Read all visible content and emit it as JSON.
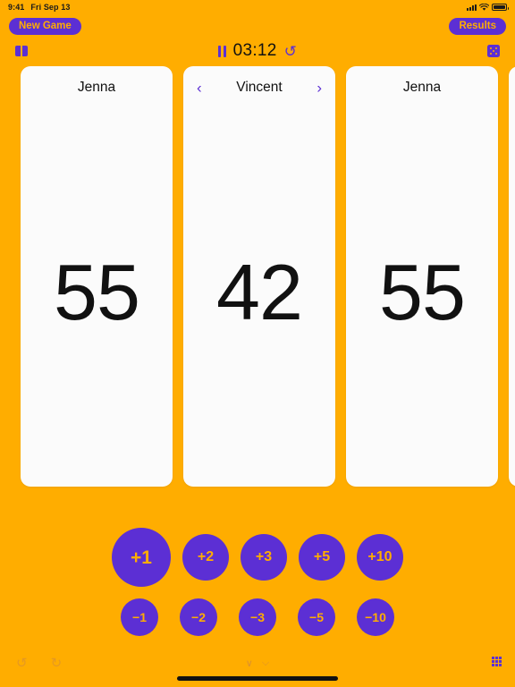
{
  "status_bar": {
    "time": "9:41",
    "date": "Fri Sep 13",
    "signal_icon": "cellular-signal-icon",
    "wifi_icon": "wifi-icon",
    "battery_icon": "battery-icon"
  },
  "nav": {
    "new_game_label": "New Game",
    "results_label": "Results"
  },
  "toolbar": {
    "rules_icon": "book-icon",
    "pause_icon": "pause-icon",
    "timer": "03:12",
    "reset_icon": "↺",
    "dice_icon": "dice-icon"
  },
  "players": [
    {
      "name": "Jenna",
      "score": "55",
      "active": false
    },
    {
      "name": "Vincent",
      "score": "42",
      "active": true,
      "prev_icon": "‹",
      "next_icon": "›"
    },
    {
      "name": "Jenna",
      "score": "55",
      "active": false
    },
    {
      "name": "",
      "score": "",
      "active": false
    }
  ],
  "score_buttons": {
    "plus": [
      {
        "label": "+1",
        "emphasis": true
      },
      {
        "label": "+2",
        "emphasis": false
      },
      {
        "label": "+3",
        "emphasis": false
      },
      {
        "label": "+5",
        "emphasis": false
      },
      {
        "label": "+10",
        "emphasis": false
      }
    ],
    "minus": [
      {
        "label": "−1"
      },
      {
        "label": "−2"
      },
      {
        "label": "−3"
      },
      {
        "label": "−5"
      },
      {
        "label": "−10"
      }
    ]
  },
  "keyboard_bar": {
    "undo_icon": "↺",
    "redo_icon": "↻",
    "format_left_icon": "∨",
    "format_right_icon": "⌵",
    "dismiss_keyboard_icon": "keyboard-dismiss-icon"
  },
  "colors": {
    "background": "#FFAD00",
    "accent": "#5C2FD4",
    "card": "#FBFBFB",
    "text": "#111111"
  }
}
